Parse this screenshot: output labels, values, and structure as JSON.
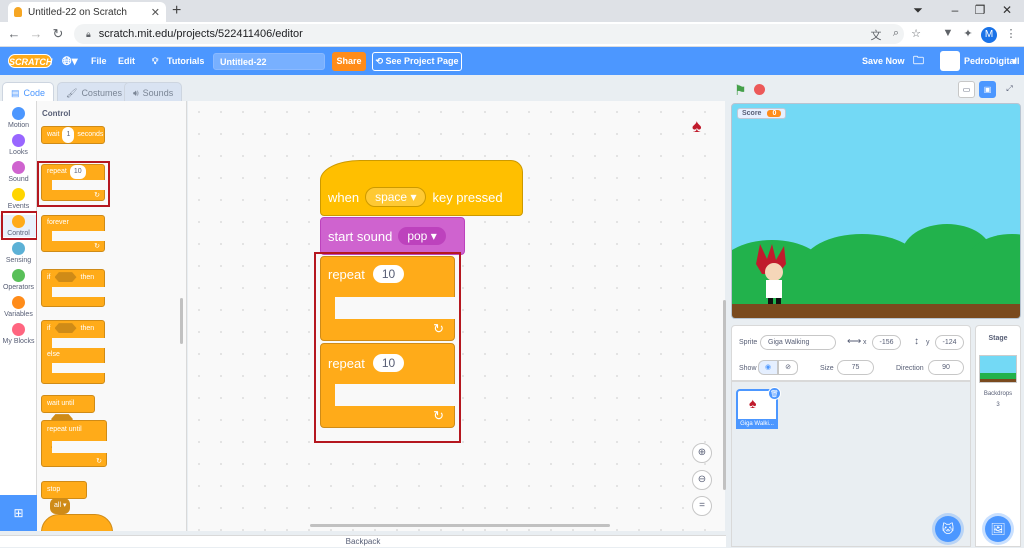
{
  "browser": {
    "tab_title": "Untitled-22 on Scratch",
    "url": "scratch.mit.edu/projects/522411406/editor",
    "profile_initial": "M"
  },
  "menubar": {
    "logo": "SCRATCH",
    "file": "File",
    "edit": "Edit",
    "tutorials": "Tutorials",
    "project_title": "Untitled-22",
    "share": "Share",
    "see_project_page": "See Project Page",
    "save_now": "Save Now",
    "username": "PedroDigitall"
  },
  "editor_tabs": [
    "Code",
    "Costumes",
    "Sounds"
  ],
  "categories": [
    {
      "label": "Motion",
      "color": "#4c97ff"
    },
    {
      "label": "Looks",
      "color": "#9966ff"
    },
    {
      "label": "Sound",
      "color": "#cf63cf"
    },
    {
      "label": "Events",
      "color": "#ffd500"
    },
    {
      "label": "Control",
      "color": "#ffab19"
    },
    {
      "label": "Sensing",
      "color": "#5cb1d6"
    },
    {
      "label": "Operators",
      "color": "#59c059"
    },
    {
      "label": "Variables",
      "color": "#ff8c1a"
    },
    {
      "label": "My Blocks",
      "color": "#ff6680"
    }
  ],
  "palette": {
    "title": "Control",
    "wait": "wait",
    "wait_value": "1",
    "seconds": "seconds",
    "repeat": "repeat",
    "repeat_value": "10",
    "forever": "forever",
    "if": "if",
    "then": "then",
    "else": "else",
    "wait_until": "wait until",
    "repeat_until": "repeat until",
    "stop": "stop",
    "stop_value": "all"
  },
  "script": {
    "when": "when",
    "key": "space",
    "key_pressed": "key pressed",
    "start_sound": "start sound",
    "sound": "pop",
    "repeat1": "repeat",
    "repeat1_value": "10",
    "repeat2": "repeat",
    "repeat2_value": "10"
  },
  "stage": {
    "score_label": "Score",
    "score_value": "0"
  },
  "sprite_info": {
    "sprite_label": "Sprite",
    "sprite_name": "Giga Walking",
    "x_label": "x",
    "x_value": "-156",
    "y_label": "y",
    "y_value": "-124",
    "show_label": "Show",
    "size_label": "Size",
    "size_value": "75",
    "direction_label": "Direction",
    "direction_value": "90",
    "thumb_label": "Giga Walki..."
  },
  "stage_panel": {
    "title": "Stage",
    "backdrops_label": "Backdrops",
    "backdrops_count": "3"
  },
  "backpack": "Backpack"
}
